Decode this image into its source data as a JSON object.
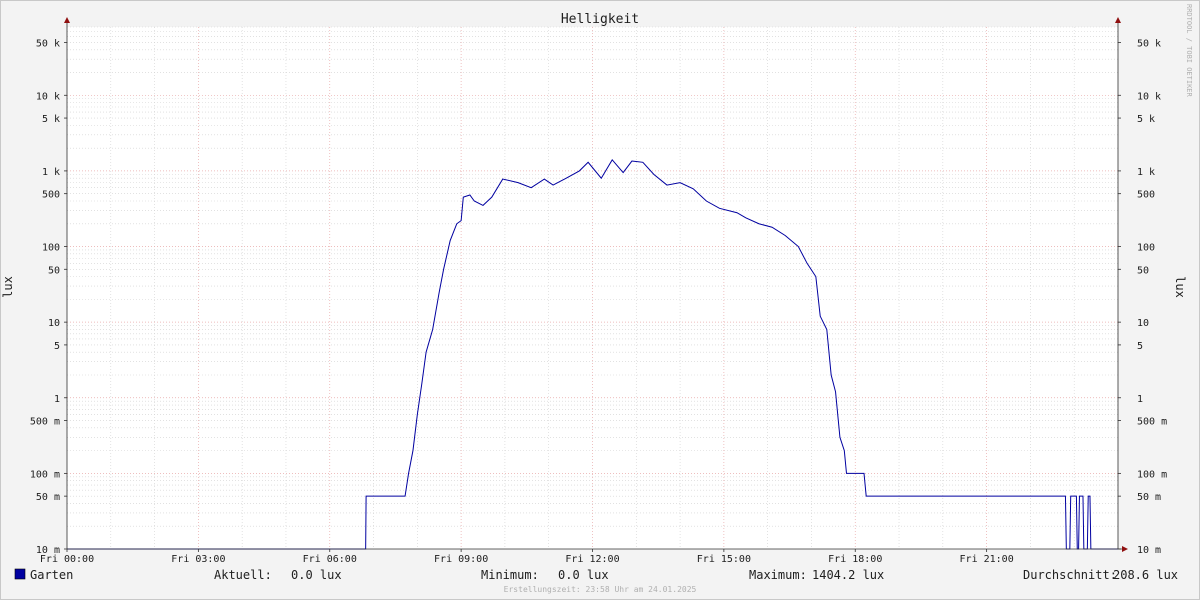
{
  "chart_data": {
    "type": "line",
    "title": "Helligkeit",
    "ylabel_left": "lux",
    "ylabel_right": "lux",
    "watermark": "RRDTOOL / TOBI OETIKER",
    "footer": "Erstellungszeit: 23:58 Uhr am 24.01.2025",
    "y_scale": "log",
    "ylim": [
      0.01,
      80000
    ],
    "xlim_hours": [
      0,
      24
    ],
    "grid": true,
    "colors": {
      "series": "#0000a0",
      "major_grid": "#e8a8a8",
      "minor_grid": "#d0d0d0",
      "axis": "#303030",
      "arrow": "#901010",
      "plot_bg": "#ffffff",
      "page_bg": "#f3f3f3"
    },
    "y_ticks": [
      {
        "value": 0.01,
        "label": "10 m"
      },
      {
        "value": 0.05,
        "label": "50 m"
      },
      {
        "value": 0.1,
        "label": "100 m"
      },
      {
        "value": 0.5,
        "label": "500 m"
      },
      {
        "value": 1,
        "label": "1"
      },
      {
        "value": 5,
        "label": "5"
      },
      {
        "value": 10,
        "label": "10"
      },
      {
        "value": 50,
        "label": "50"
      },
      {
        "value": 100,
        "label": "100"
      },
      {
        "value": 500,
        "label": "500"
      },
      {
        "value": 1000,
        "label": "1 k"
      },
      {
        "value": 5000,
        "label": "5 k"
      },
      {
        "value": 10000,
        "label": "10 k"
      },
      {
        "value": 50000,
        "label": "50 k"
      }
    ],
    "x_ticks": [
      {
        "hour": 0,
        "label": "Fri 00:00"
      },
      {
        "hour": 3,
        "label": "Fri 03:00"
      },
      {
        "hour": 6,
        "label": "Fri 06:00"
      },
      {
        "hour": 9,
        "label": "Fri 09:00"
      },
      {
        "hour": 12,
        "label": "Fri 12:00"
      },
      {
        "hour": 15,
        "label": "Fri 15:00"
      },
      {
        "hour": 18,
        "label": "Fri 18:00"
      },
      {
        "hour": 21,
        "label": "Fri 21:00"
      }
    ],
    "series": [
      {
        "name": "Garten",
        "color": "#0000a0",
        "points": [
          [
            0,
            0.01
          ],
          [
            6.82,
            0.01
          ],
          [
            6.83,
            0.05
          ],
          [
            7.72,
            0.05
          ],
          [
            7.8,
            0.1
          ],
          [
            7.9,
            0.2
          ],
          [
            8.0,
            0.6
          ],
          [
            8.1,
            1.5
          ],
          [
            8.2,
            4
          ],
          [
            8.35,
            8
          ],
          [
            8.5,
            25
          ],
          [
            8.6,
            50
          ],
          [
            8.75,
            120
          ],
          [
            8.9,
            200
          ],
          [
            9.0,
            220
          ],
          [
            9.05,
            450
          ],
          [
            9.2,
            480
          ],
          [
            9.3,
            400
          ],
          [
            9.5,
            350
          ],
          [
            9.7,
            450
          ],
          [
            9.95,
            780
          ],
          [
            10.3,
            700
          ],
          [
            10.6,
            600
          ],
          [
            10.9,
            780
          ],
          [
            11.1,
            650
          ],
          [
            11.4,
            800
          ],
          [
            11.7,
            1000
          ],
          [
            11.9,
            1300
          ],
          [
            12.2,
            800
          ],
          [
            12.45,
            1400
          ],
          [
            12.7,
            950
          ],
          [
            12.9,
            1350
          ],
          [
            13.15,
            1300
          ],
          [
            13.4,
            900
          ],
          [
            13.7,
            650
          ],
          [
            14.0,
            700
          ],
          [
            14.3,
            580
          ],
          [
            14.6,
            400
          ],
          [
            14.9,
            320
          ],
          [
            15.3,
            280
          ],
          [
            15.5,
            240
          ],
          [
            15.8,
            200
          ],
          [
            16.1,
            180
          ],
          [
            16.4,
            140
          ],
          [
            16.7,
            100
          ],
          [
            16.9,
            60
          ],
          [
            17.1,
            40
          ],
          [
            17.2,
            12
          ],
          [
            17.35,
            8
          ],
          [
            17.45,
            2
          ],
          [
            17.55,
            1.2
          ],
          [
            17.65,
            0.3
          ],
          [
            17.75,
            0.2
          ],
          [
            17.8,
            0.1
          ],
          [
            18.2,
            0.1
          ],
          [
            18.25,
            0.05
          ],
          [
            22.8,
            0.05
          ],
          [
            22.82,
            0.01
          ],
          [
            22.9,
            0.01
          ],
          [
            22.92,
            0.05
          ],
          [
            23.05,
            0.05
          ],
          [
            23.07,
            0.01
          ],
          [
            23.1,
            0.01
          ],
          [
            23.12,
            0.05
          ],
          [
            23.2,
            0.05
          ],
          [
            23.22,
            0.01
          ],
          [
            23.3,
            0.01
          ],
          [
            23.32,
            0.05
          ],
          [
            23.36,
            0.05
          ],
          [
            23.38,
            0.01
          ],
          [
            24,
            0.01
          ]
        ]
      }
    ]
  },
  "legend": {
    "series_name": "Garten",
    "stats": [
      {
        "label": "Aktuell:",
        "value": "0.0 lux"
      },
      {
        "label": "Minimum:",
        "value": "0.0 lux"
      },
      {
        "label": "Maximum:",
        "value": "1404.2 lux"
      },
      {
        "label": "Durchschnitt:",
        "value": "208.6 lux"
      }
    ]
  }
}
